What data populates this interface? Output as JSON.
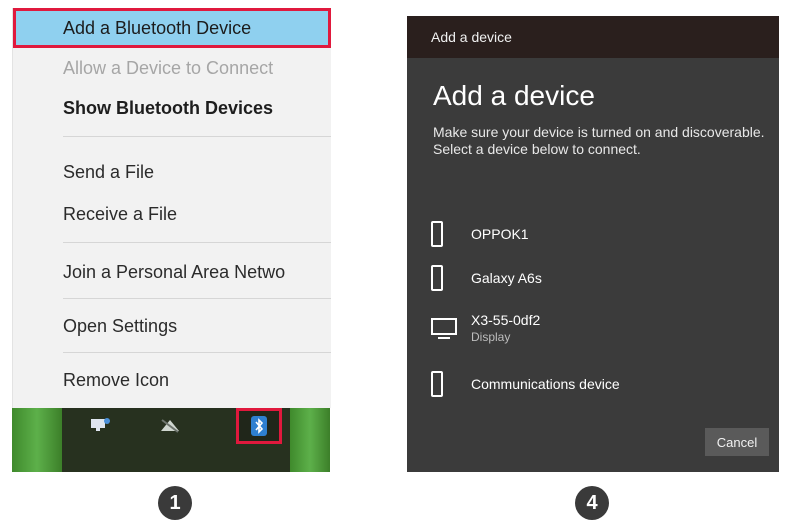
{
  "menu": {
    "items": [
      {
        "label": "Add a Bluetooth Device"
      },
      {
        "label": "Allow a Device to Connect"
      },
      {
        "label": "Show Bluetooth Devices"
      },
      {
        "label": "Send a File"
      },
      {
        "label": "Receive a File"
      },
      {
        "label": "Join a Personal Area Netwo"
      },
      {
        "label": "Open Settings"
      },
      {
        "label": "Remove Icon"
      }
    ]
  },
  "steps": [
    "1",
    "4"
  ],
  "dialog": {
    "titlebar": "Add a device",
    "heading": "Add a device",
    "description": "Make sure your device is turned on and discoverable. Select a device below to connect.",
    "devices": [
      {
        "name": "OPPOK1",
        "icon": "phone-icon"
      },
      {
        "name": "Galaxy A6s",
        "icon": "phone-icon"
      },
      {
        "name": "X3-55-0df2",
        "subtitle": "Display",
        "icon": "monitor-icon"
      },
      {
        "name": "Communications device",
        "icon": "phone-icon"
      }
    ],
    "cancel_label": "Cancel"
  },
  "colors": {
    "menu_bg": "#f2f2f2",
    "highlight_bg": "#8fd0ef",
    "red_frame": "#e0193d",
    "dialog_bg": "#3b3b3b",
    "dialog_titlebar": "#2a1f1d"
  }
}
